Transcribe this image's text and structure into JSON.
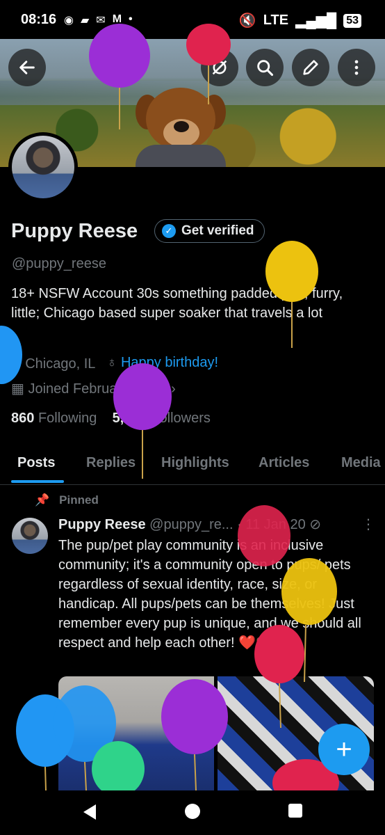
{
  "status": {
    "time": "08:16",
    "notif_icons": [
      "messenger-icon",
      "chat-icon",
      "mail-icon",
      "gmail-icon",
      "dot-icon"
    ],
    "network": "LTE",
    "battery": "53"
  },
  "profile": {
    "name": "Puppy Reese",
    "get_verified": "Get verified",
    "handle": "@puppy_reese",
    "bio": "18+ NSFW Account 30s something padded pup, furry, little; Chicago based super soaker that travels a lot",
    "location": "Chicago, IL",
    "birthday": "Happy birthday!",
    "joined": "Joined February 2016",
    "following_count": "860",
    "following_label": "Following",
    "followers_count": "5,084",
    "followers_label": "Followers"
  },
  "tabs": [
    "Posts",
    "Replies",
    "Highlights",
    "Articles",
    "Media"
  ],
  "pinned_label": "Pinned",
  "tweet": {
    "name": "Puppy Reese",
    "handle": "@puppy_re...",
    "separator": "·",
    "date": "11 Jan 20",
    "text": "The pup/pet play community is an inclusive community; it's a community open to pups/ pets regardless of sexual identity, race, size, or handicap.  All pups/pets can be themselves!  Just remember every pup is unique, and we should all respect and help each other! ❤️🐶❤️"
  },
  "fab_label": "+",
  "colors": {
    "accent": "#1d9bf0",
    "background": "#000000",
    "text": "#e7e9ea",
    "muted": "#71767b"
  }
}
